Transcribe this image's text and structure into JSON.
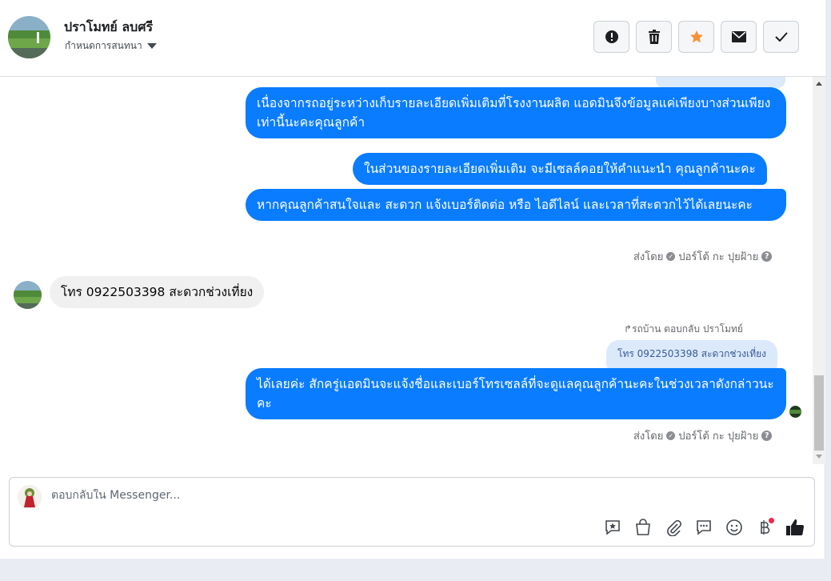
{
  "header": {
    "contact_name": "ปราโมทย์ ลบศรี",
    "settings_label": "กำหนดการสนทนา",
    "actions": [
      {
        "name": "report-spam-button",
        "icon": "alert-icon"
      },
      {
        "name": "delete-button",
        "icon": "trash-icon"
      },
      {
        "name": "star-button",
        "icon": "star-icon"
      },
      {
        "name": "mark-unread-button",
        "icon": "envelope-icon"
      },
      {
        "name": "mark-done-button",
        "icon": "check-icon"
      }
    ]
  },
  "messages": {
    "out1": "เนื่องจากรถอยู่ระหว่างเก็บรายละเอียดเพิ่มเติมที่โรงงานผลิต แอดมินจึงข้อมูลแค่เพียงบางส่วนเพียงเท่านี้นะคะคุณลูกค้า",
    "out2": "ในส่วนของรายละเอียดเพิ่มเติม จะมีเซลล์คอยให้คำแนะนำ คุณลูกค้านะคะ",
    "out3": "หากคุณลูกค้าสนใจและ สะดวก แจ้งเบอร์ติดต่อ หรือ ไอดีไลน์ และเวลาที่สะดวกไว้ได้เลยนะคะ",
    "sent_by_1": "ส่งโดย",
    "sender_1": "ปอร์โต้ กะ ปุยฝ้าย",
    "in1": "โทร 0922503398 สะดวกช่วงเที่ยง",
    "reply_note": "รถบ้าน ตอบกลับ ปราโมทย์",
    "quoted": "โทร 0922503398 สะดวกช่วงเที่ยง",
    "out4": "ได้เลยค่ะ สักครู่แอดมินจะแจ้งชื่อและเบอร์โทรเซลล์ที่จะดูแลคุณลูกค้านะคะในช่วงเวลาดังกล่าวนะคะ",
    "sent_by_2": "ส่งโดย",
    "sender_2": "ปอร์โต้ กะ ปุยฝ้าย"
  },
  "composer": {
    "placeholder": "ตอบกลับใน Messenger...",
    "tools": [
      "saved-reply-icon",
      "shop-bag-icon",
      "attachment-icon",
      "chat-bubble-icon",
      "emoji-icon",
      "baht-icon",
      "thumbs-up-icon"
    ]
  },
  "colors": {
    "outgoing_bubble": "#0a7cff",
    "incoming_bubble": "#f0f0f0",
    "star": "#f7923b",
    "notification_dot": "#f02849"
  }
}
